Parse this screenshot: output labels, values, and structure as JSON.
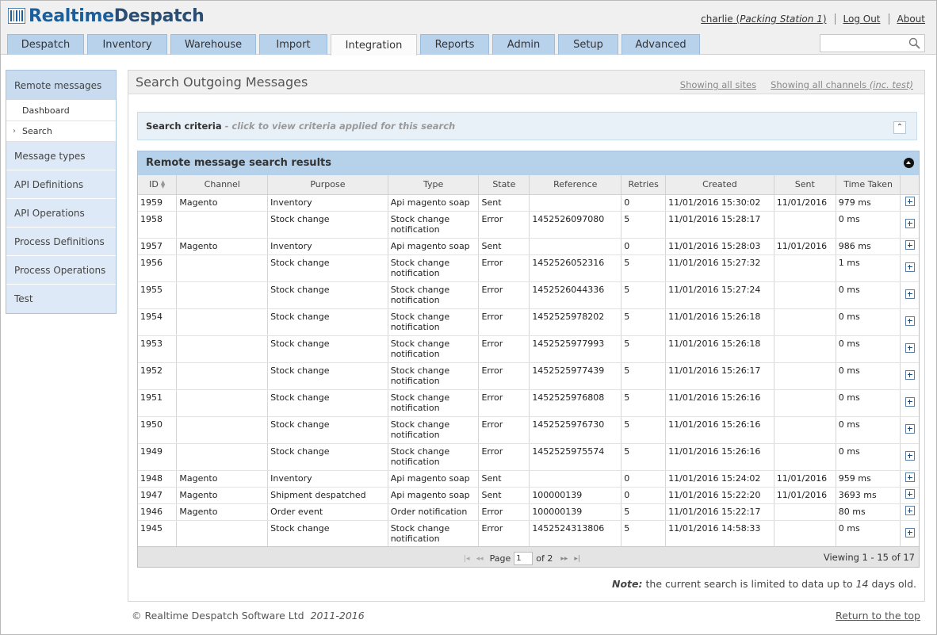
{
  "app": {
    "logo_part1": "Realtime",
    "logo_part2": "Despatch",
    "user": "charlie",
    "station": "Packing Station 1",
    "logout": "Log Out",
    "about": "About"
  },
  "tabs": [
    {
      "label": "Despatch",
      "active": false
    },
    {
      "label": "Inventory",
      "active": false
    },
    {
      "label": "Warehouse",
      "active": false
    },
    {
      "label": "Import",
      "active": false
    },
    {
      "label": "Integration",
      "active": true
    },
    {
      "label": "Reports",
      "active": false
    },
    {
      "label": "Admin",
      "active": false
    },
    {
      "label": "Setup",
      "active": false
    },
    {
      "label": "Advanced",
      "active": false
    }
  ],
  "search": {
    "placeholder": "",
    "icon": "search-icon"
  },
  "sidebar": {
    "items": [
      {
        "label": "Remote messages"
      },
      {
        "label": "Message types"
      },
      {
        "label": "API Definitions"
      },
      {
        "label": "API Operations"
      },
      {
        "label": "Process Definitions"
      },
      {
        "label": "Process Operations"
      },
      {
        "label": "Test"
      }
    ],
    "sub_items": [
      {
        "label": "Dashboard"
      },
      {
        "label": "Search"
      }
    ]
  },
  "main": {
    "title": "Search Outgoing Messages",
    "sites_link": "Showing all sites",
    "channels_link": "Showing all channels",
    "channels_suffix": "(inc. test)",
    "criteria_label": "Search criteria",
    "criteria_hint": "- click to view criteria applied for this search",
    "results_title": "Remote message search results",
    "note_label": "Note:",
    "note_text_1": " the current search is limited to data up to ",
    "note_days": "14",
    "note_text_2": " days old."
  },
  "table": {
    "columns": [
      "ID",
      "Channel",
      "Purpose",
      "Type",
      "State",
      "Reference",
      "Retries",
      "Created",
      "Sent",
      "Time Taken"
    ],
    "rows": [
      {
        "id": "1959",
        "channel": "Magento",
        "purpose": "Inventory",
        "type": "Api magento soap",
        "state": "Sent",
        "reference": "",
        "retries": "0",
        "created": "11/01/2016 15:30:02",
        "sent": "11/01/2016",
        "time": "979 ms"
      },
      {
        "id": "1958",
        "channel": "",
        "purpose": "Stock change",
        "type": "Stock change notification",
        "state": "Error",
        "reference": "1452526097080",
        "retries": "5",
        "created": "11/01/2016 15:28:17",
        "sent": "",
        "time": "0 ms"
      },
      {
        "id": "1957",
        "channel": "Magento",
        "purpose": "Inventory",
        "type": "Api magento soap",
        "state": "Sent",
        "reference": "",
        "retries": "0",
        "created": "11/01/2016 15:28:03",
        "sent": "11/01/2016",
        "time": "986 ms"
      },
      {
        "id": "1956",
        "channel": "",
        "purpose": "Stock change",
        "type": "Stock change notification",
        "state": "Error",
        "reference": "1452526052316",
        "retries": "5",
        "created": "11/01/2016 15:27:32",
        "sent": "",
        "time": "1 ms"
      },
      {
        "id": "1955",
        "channel": "",
        "purpose": "Stock change",
        "type": "Stock change notification",
        "state": "Error",
        "reference": "1452526044336",
        "retries": "5",
        "created": "11/01/2016 15:27:24",
        "sent": "",
        "time": "0 ms"
      },
      {
        "id": "1954",
        "channel": "",
        "purpose": "Stock change",
        "type": "Stock change notification",
        "state": "Error",
        "reference": "1452525978202",
        "retries": "5",
        "created": "11/01/2016 15:26:18",
        "sent": "",
        "time": "0 ms"
      },
      {
        "id": "1953",
        "channel": "",
        "purpose": "Stock change",
        "type": "Stock change notification",
        "state": "Error",
        "reference": "1452525977993",
        "retries": "5",
        "created": "11/01/2016 15:26:18",
        "sent": "",
        "time": "0 ms"
      },
      {
        "id": "1952",
        "channel": "",
        "purpose": "Stock change",
        "type": "Stock change notification",
        "state": "Error",
        "reference": "1452525977439",
        "retries": "5",
        "created": "11/01/2016 15:26:17",
        "sent": "",
        "time": "0 ms"
      },
      {
        "id": "1951",
        "channel": "",
        "purpose": "Stock change",
        "type": "Stock change notification",
        "state": "Error",
        "reference": "1452525976808",
        "retries": "5",
        "created": "11/01/2016 15:26:16",
        "sent": "",
        "time": "0 ms"
      },
      {
        "id": "1950",
        "channel": "",
        "purpose": "Stock change",
        "type": "Stock change notification",
        "state": "Error",
        "reference": "1452525976730",
        "retries": "5",
        "created": "11/01/2016 15:26:16",
        "sent": "",
        "time": "0 ms"
      },
      {
        "id": "1949",
        "channel": "",
        "purpose": "Stock change",
        "type": "Stock change notification",
        "state": "Error",
        "reference": "1452525975574",
        "retries": "5",
        "created": "11/01/2016 15:26:16",
        "sent": "",
        "time": "0 ms"
      },
      {
        "id": "1948",
        "channel": "Magento",
        "purpose": "Inventory",
        "type": "Api magento soap",
        "state": "Sent",
        "reference": "",
        "retries": "0",
        "created": "11/01/2016 15:24:02",
        "sent": "11/01/2016",
        "time": "959 ms"
      },
      {
        "id": "1947",
        "channel": "Magento",
        "purpose": "Shipment despatched",
        "type": "Api magento soap",
        "state": "Sent",
        "reference": "100000139",
        "retries": "0",
        "created": "11/01/2016 15:22:20",
        "sent": "11/01/2016",
        "time": "3693 ms"
      },
      {
        "id": "1946",
        "channel": "Magento",
        "purpose": "Order event",
        "type": "Order notification",
        "state": "Error",
        "reference": "100000139",
        "retries": "5",
        "created": "11/01/2016 15:22:17",
        "sent": "",
        "time": "80 ms"
      },
      {
        "id": "1945",
        "channel": "",
        "purpose": "Stock change",
        "type": "Stock change notification",
        "state": "Error",
        "reference": "1452524313806",
        "retries": "5",
        "created": "11/01/2016 14:58:33",
        "sent": "",
        "time": "0 ms"
      }
    ]
  },
  "pager": {
    "page_label": "Page",
    "page_value": "1",
    "of_label": "of 2",
    "viewing": "Viewing 1 - 15 of 17"
  },
  "footer": {
    "copyright": "© Realtime Despatch Software Ltd",
    "years": "2011-2016",
    "top_link": "Return to the top"
  }
}
